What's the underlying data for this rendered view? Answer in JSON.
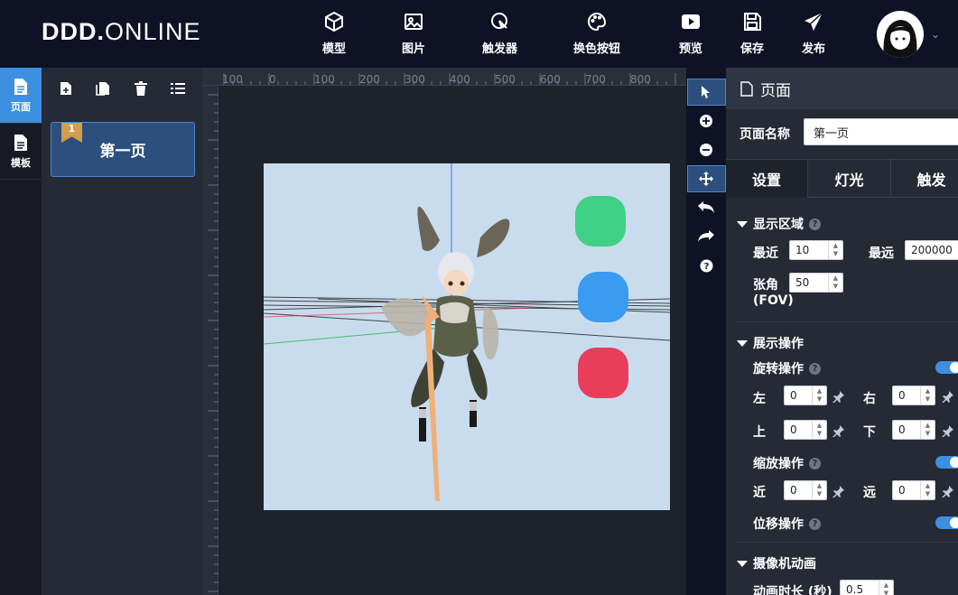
{
  "app": {
    "logo_bold": "DDD.",
    "logo_light": "ONLINE"
  },
  "topnav": [
    {
      "label": "模型",
      "icon": "cube-icon"
    },
    {
      "label": "图片",
      "icon": "image-icon"
    },
    {
      "label": "触发器",
      "icon": "cursor-click-icon"
    },
    {
      "label": "换色按钮",
      "icon": "palette-icon"
    },
    {
      "label": "预览",
      "icon": "play-icon"
    },
    {
      "label": "保存",
      "icon": "save-icon"
    },
    {
      "label": "发布",
      "icon": "send-icon"
    }
  ],
  "leftnav": [
    {
      "label": "页面",
      "icon": "page-icon",
      "active": true
    },
    {
      "label": "模板",
      "icon": "template-icon",
      "active": false
    }
  ],
  "pages": {
    "items": [
      {
        "number": "1",
        "name": "第一页"
      }
    ]
  },
  "ruler": {
    "ticks": [
      "100",
      "0",
      "100",
      "200",
      "300",
      "400",
      "500",
      "600",
      "700",
      "800"
    ]
  },
  "properties": {
    "header": "页面",
    "page_name_label": "页面名称",
    "page_name_value": "第一页",
    "tabs": [
      "设置",
      "灯光",
      "触发"
    ],
    "display_area": {
      "title": "显示区域",
      "near_label": "最近",
      "near_value": "10",
      "far_label": "最远",
      "far_value": "200000",
      "fov_label_1": "张角",
      "fov_label_2": "(FOV)",
      "fov_value": "50"
    },
    "display_ops": {
      "title": "展示操作",
      "rotate_label": "旋转操作",
      "left_label": "左",
      "left_value": "0",
      "right_label": "右",
      "right_value": "0",
      "up_label": "上",
      "up_value": "0",
      "down_label": "下",
      "down_value": "0",
      "zoom_label": "缩放操作",
      "near_label": "近",
      "near_value": "0",
      "far_label": "远",
      "far_value": "0",
      "pan_label": "位移操作"
    },
    "camera_anim": {
      "title": "摄像机动画",
      "duration_label": "动画时长 (秒)",
      "duration_value": "0.5"
    }
  },
  "colors": {
    "accent": "#3d8fe0",
    "topbar": "#0f1224",
    "stage": "#c9dcee"
  }
}
